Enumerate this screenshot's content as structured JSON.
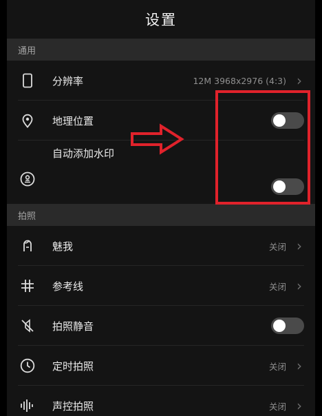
{
  "header": {
    "title": "设置"
  },
  "sections": {
    "general": {
      "title": "通用",
      "resolution": {
        "label": "分辨率",
        "value": "12M 3968x2976 (4:3)",
        "icon": "smartphone-icon"
      },
      "location": {
        "label": "地理位置",
        "toggle_on": false,
        "icon": "location-pin-icon"
      },
      "watermark": {
        "label": "自动添加水印",
        "toggle_on": false,
        "icon": "stamp-icon"
      }
    },
    "photo": {
      "title": "拍照",
      "beauty": {
        "label": "魅我",
        "value": "关闭",
        "icon": "beauty-face-icon"
      },
      "grid": {
        "label": "参考线",
        "value": "关闭",
        "icon": "grid-icon"
      },
      "mute": {
        "label": "拍照静音",
        "toggle_on": false,
        "icon": "mute-icon"
      },
      "timer": {
        "label": "定时拍照",
        "value": "关闭",
        "icon": "clock-icon"
      },
      "voice": {
        "label": "声控拍照",
        "value": "关闭",
        "icon": "sound-wave-icon"
      }
    }
  },
  "annotation": {
    "box_color": "#e0222b",
    "arrow_color": "#e0222b"
  }
}
